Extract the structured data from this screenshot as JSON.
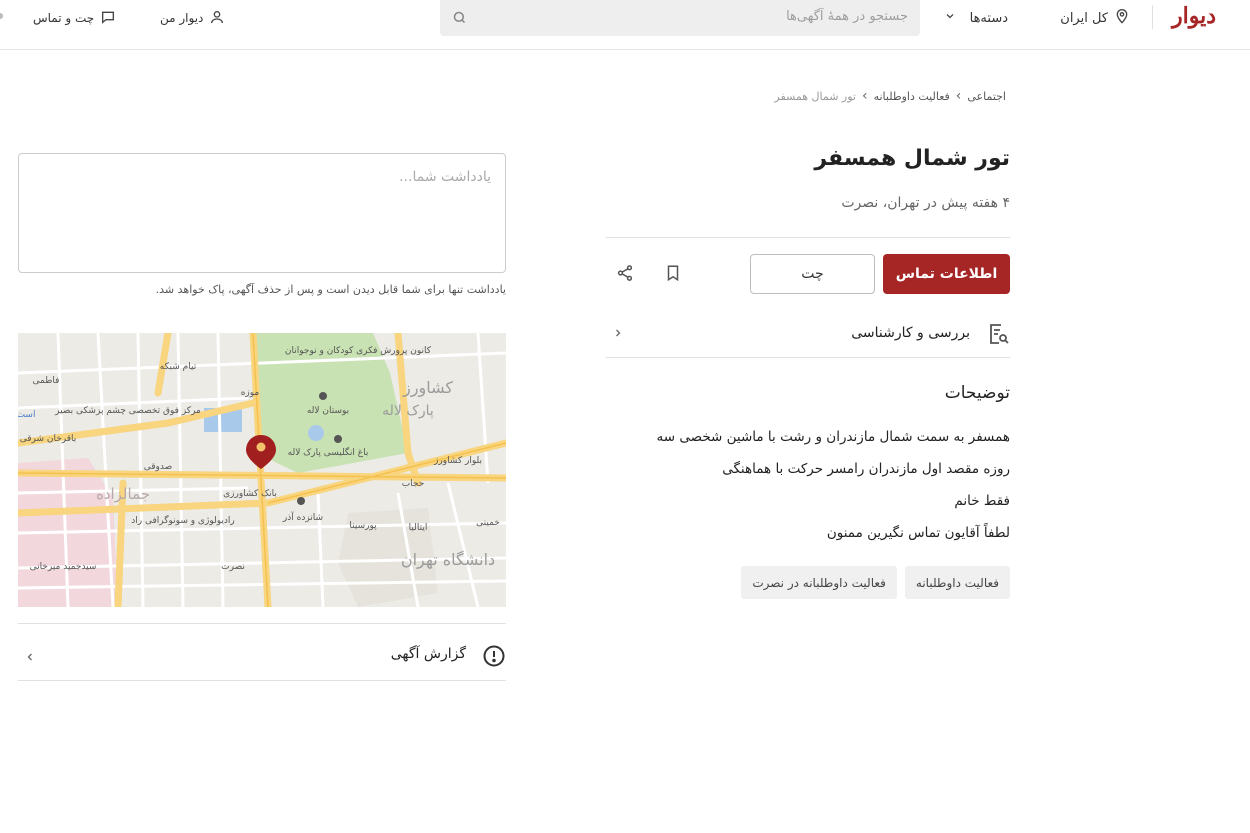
{
  "header": {
    "logo": "دیوار",
    "city": "کل ایران",
    "categories": "دسته‌ها",
    "search_placeholder": "جستجو در همهٔ آگهی‌ها",
    "my_divar": "دیوار من",
    "chat": "چت و تماس"
  },
  "breadcrumb": {
    "items": [
      "اجتماعی",
      "فعالیت داوطلبانه",
      "تور شمال همسفر"
    ]
  },
  "post": {
    "title": "تور شمال همسفر",
    "subtitle": "۴ هفته پیش در تهران، نصرت",
    "contact_button": "اطلاعات تماس",
    "chat_button": "چت",
    "review_label": "بررسی و کارشناسی",
    "description_title": "توضیحات",
    "description_lines": [
      "همسفر به سمت شمال مازندران و رشت با ماشین شخصی سه",
      "روزه مقصد اول مازندران رامسر حرکت با هماهنگی",
      "فقط خانم",
      "لطفاً آقایون تماس نگیرین ممنون"
    ],
    "tags": [
      "فعالیت داوطلبانه",
      "فعالیت داوطلبانه در نصرت"
    ]
  },
  "note": {
    "placeholder": "یادداشت شما...",
    "help": "یادداشت تنها برای شما قابل دیدن است و پس از حذف آگهی، پاک خواهد شد."
  },
  "map": {
    "labels": [
      "کانون پرورش فکری کودکان و نوجوانان",
      "تیام شبکه",
      "موزه",
      "بوستان لاله",
      "کشاورز",
      "پارک لاله",
      "مرکز فوق تخصصی چشم پزشکی بصیر",
      "باغ انگلیسی پارک لاله",
      "فاطمی",
      "بلوار کشاورز",
      "باقرخان شرقی",
      "صدوقی",
      "حجاب",
      "جمالزاده",
      "بانک کشاورزی",
      "رادیولوژی و سونوگرافی راد",
      "شانزده آذر",
      "پورسینا",
      "ایتالیا",
      "خمینی",
      "دانشگاه تهران",
      "نصرت",
      "سیدجمید میرخانی",
      "است"
    ]
  },
  "report": {
    "label": "گزارش آگهی"
  },
  "colors": {
    "brand": "#a62626",
    "park": "#c9e2b3",
    "road": "#f8d57e"
  }
}
